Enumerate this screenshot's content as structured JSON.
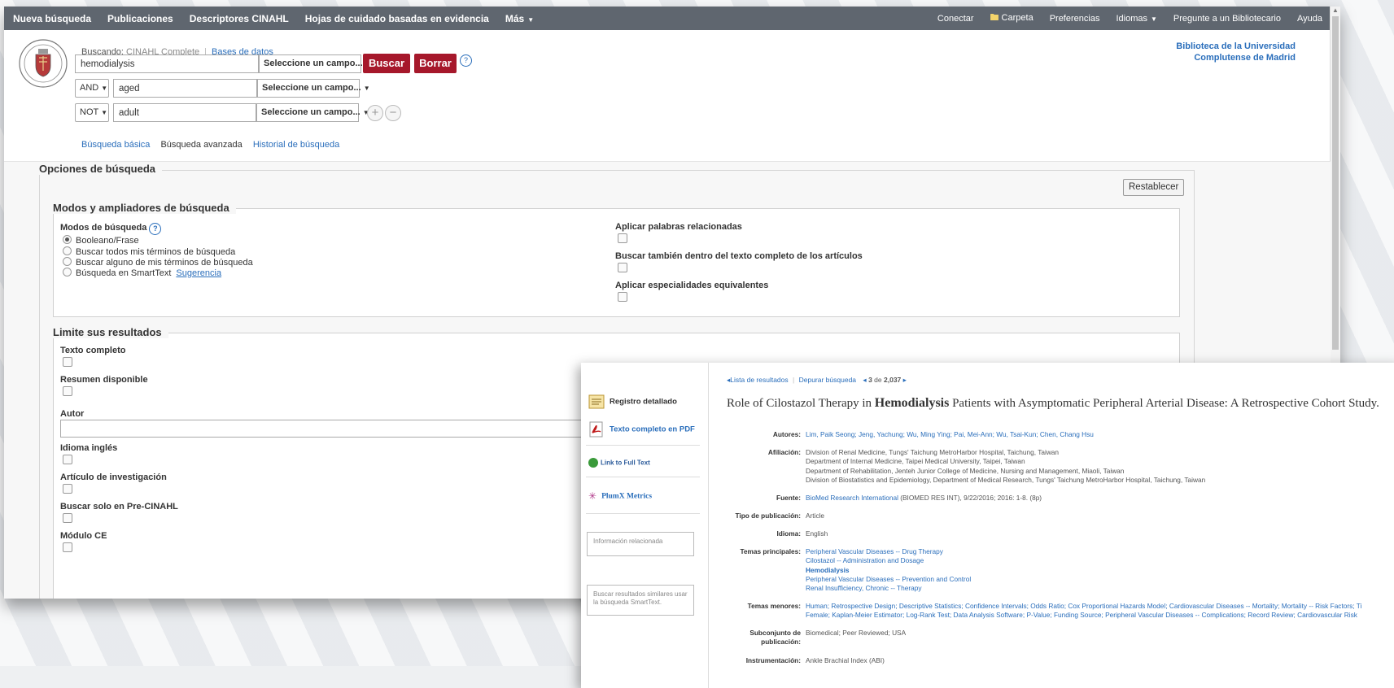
{
  "topnav": {
    "left": [
      "Nueva búsqueda",
      "Publicaciones",
      "Descriptores CINAHL",
      "Hojas de cuidado basadas en evidencia",
      "Más"
    ],
    "right": {
      "connect": "Conectar",
      "folder": "Carpeta",
      "preferences": "Preferencias",
      "languages": "Idiomas",
      "ask": "Pregunte a un Bibliotecario",
      "help": "Ayuda"
    }
  },
  "search": {
    "searching_label": "Buscando:",
    "database": "CINAHL Complete",
    "databases_link": "Bases de datos",
    "rows": [
      {
        "operator": "",
        "term": "hemodialysis",
        "field": "Seleccione un campo..."
      },
      {
        "operator": "AND",
        "term": "aged",
        "field": "Seleccione un campo..."
      },
      {
        "operator": "NOT",
        "term": "adult",
        "field": "Seleccione un campo..."
      }
    ],
    "search_button": "Buscar",
    "clear_button": "Borrar",
    "help_icon": "?",
    "add_row": "+",
    "remove_row": "−",
    "links": {
      "basic": "Búsqueda básica",
      "advanced": "Búsqueda avanzada",
      "history": "Historial de búsqueda"
    }
  },
  "library": {
    "line1": "Biblioteca de la Universidad",
    "line2": "Complutense de Madrid"
  },
  "options": {
    "legend": "Opciones de búsqueda",
    "reset_button": "Restablecer",
    "modes": {
      "legend": "Modos y ampliadores de búsqueda",
      "modes_label": "Modos de búsqueda",
      "radio_items": [
        "Booleano/Frase",
        "Buscar todos mis términos de búsqueda",
        "Buscar alguno de mis términos de búsqueda",
        "Búsqueda en SmartText"
      ],
      "selected_index": 0,
      "hint_link": "Sugerencia",
      "right_checks": [
        "Aplicar palabras relacionadas",
        "Buscar también dentro del texto completo de los artículos",
        "Aplicar especialidades equivalentes"
      ]
    },
    "limits": {
      "legend": "Limite sus resultados",
      "items": [
        "Texto completo",
        "Resumen disponible",
        "Autor",
        "Idioma inglés",
        "Artículo de investigación",
        "Buscar solo en Pre-CINAHL",
        "Módulo CE"
      ]
    }
  },
  "detail": {
    "left": {
      "detailed_record": "Registro detallado",
      "pdf_full_text": "Texto completo en PDF",
      "link_full_text": "Link to Full Text",
      "plumx": "PlumX Metrics",
      "related_info": "Información relacionada",
      "similar_results": "Buscar resultados similares usar la búsqueda SmartText."
    },
    "nav": {
      "results_list": "Lista de resultados",
      "refine": "Depurar búsqueda",
      "position": "3",
      "of_label": "de",
      "total": "2,037"
    },
    "title_pre": "Role of Cilostazol Therapy in ",
    "title_bold": "Hemodialysis",
    "title_post": " Patients with Asymptomatic Peripheral Arterial Disease: A Retrospective Cohort Study.",
    "fields": {
      "authors_label": "Autores:",
      "authors": "Lim, Paik Seong; Jeng, Yachung; Wu, Ming Ying; Pai, Mei-Ann; Wu, Tsai-Kun; Chen, Chang Hsu",
      "affiliation_label": "Afiliación:",
      "affiliation": [
        "Division of Renal Medicine, Tungs' Taichung MetroHarbor Hospital, Taichung, Taiwan",
        "Department of Internal Medicine, Taipei Medical University, Taipei, Taiwan",
        "Department of Rehabilitation, Jenteh Junior College of Medicine, Nursing and Management, Miaoli, Taiwan",
        "Division of Biostatistics and Epidemiology, Department of Medical Research, Tungs' Taichung MetroHarbor Hospital, Taichung, Taiwan"
      ],
      "source_label": "Fuente:",
      "source_link": "BioMed Research International",
      "source_rest": " (BIOMED RES INT), 9/22/2016; 2016: 1-8. (8p)",
      "pubtype_label": "Tipo de publicación:",
      "pubtype": "Article",
      "language_label": "Idioma:",
      "language": "English",
      "major_label": "Temas principales:",
      "major": [
        "Peripheral Vascular Diseases -- Drug Therapy",
        "Cilostazol -- Administration and Dosage",
        "Hemodialysis",
        "Peripheral Vascular Diseases -- Prevention and Control",
        "Renal Insufficiency, Chronic -- Therapy"
      ],
      "minor_label": "Temas menores:",
      "minor": [
        "Human; Retrospective Design; Descriptive Statistics; Confidence Intervals; Odds Ratio; Cox Proportional Hazards Model; Cardiovascular Diseases -- Mortality; Mortality -- Risk Factors; Ti",
        "Female; Kaplan-Meier Estimator; Log-Rank Test; Data Analysis Software; P-Value; Funding Source; Peripheral Vascular Diseases -- Complications; Record Review; Cardiovascular Risk"
      ],
      "subset_label_1": "Subconjunto de",
      "subset_label_2": "publicación:",
      "subset": "Biomedical; Peer Reviewed; USA",
      "instr_label": "Instrumentación:",
      "instr": "Ankle Brachial Index (ABI)"
    }
  }
}
